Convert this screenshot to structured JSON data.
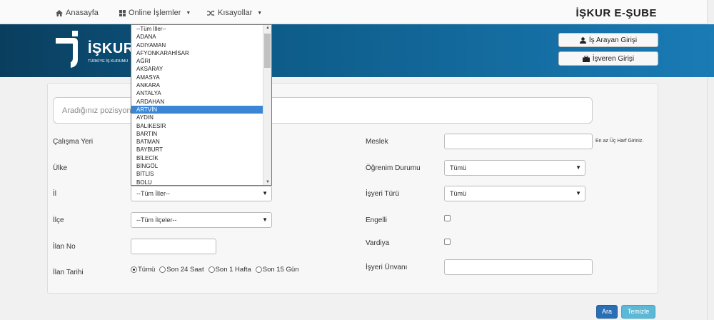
{
  "topnav": {
    "home": {
      "label": "Anasayfa",
      "icon": "home-icon"
    },
    "online": {
      "label": "Online İşlemler",
      "icon": "grid-icon"
    },
    "shortcuts": {
      "label": "Kısayollar",
      "icon": "shuffle-icon"
    },
    "brand": "İŞKUR E-ŞUBE"
  },
  "banner": {
    "logo_text": "İŞKUR",
    "logo_sub": "TÜRKİYE İŞ KURUMU",
    "job_seeker_login": "İş Arayan Girişi",
    "employer_login": "İşveren Girişi",
    "colors": {
      "dark": "#0a3e5e",
      "light": "#1a7bb5"
    }
  },
  "search": {
    "placeholder": "Aradığınız pozisyon, m"
  },
  "form": {
    "work_place_label": "Çalışma Yeri",
    "country_label": "Ülke",
    "city_label": "İl",
    "city_value": "--Tüm İller--",
    "district_label": "İlçe",
    "district_value": "--Tüm İlçeler--",
    "listing_no_label": "İlan No",
    "listing_date_label": "İlan Tarihi",
    "date_options": [
      "Tümü",
      "Son 24 Saat",
      "Son 1 Hafta",
      "Son 15 Gün"
    ],
    "date_selected": "Tümü",
    "profession_label": "Meslek",
    "profession_hint": "En az Üç Harf Giriniz.",
    "education_label": "Öğrenim Durumu",
    "education_value": "Tümü",
    "workplace_type_label": "İşyeri Türü",
    "workplace_type_value": "Tümü",
    "disabled_label": "Engelli",
    "shift_label": "Vardiya",
    "workplace_title_label": "İşyeri Ünvanı"
  },
  "city_dropdown": {
    "options": [
      "--Tüm İller--",
      "ADANA",
      "ADIYAMAN",
      "AFYONKARAHİSAR",
      "AĞRI",
      "AKSARAY",
      "AMASYA",
      "ANKARA",
      "ANTALYA",
      "ARDAHAN",
      "ARTVİN",
      "AYDIN",
      "BALIKESİR",
      "BARTIN",
      "BATMAN",
      "BAYBURT",
      "BİLECİK",
      "BİNGÖL",
      "BİTLİS",
      "BOLU"
    ],
    "highlighted": "ARTVİN"
  },
  "actions": {
    "search": "Ara",
    "clear": "Temizle"
  }
}
